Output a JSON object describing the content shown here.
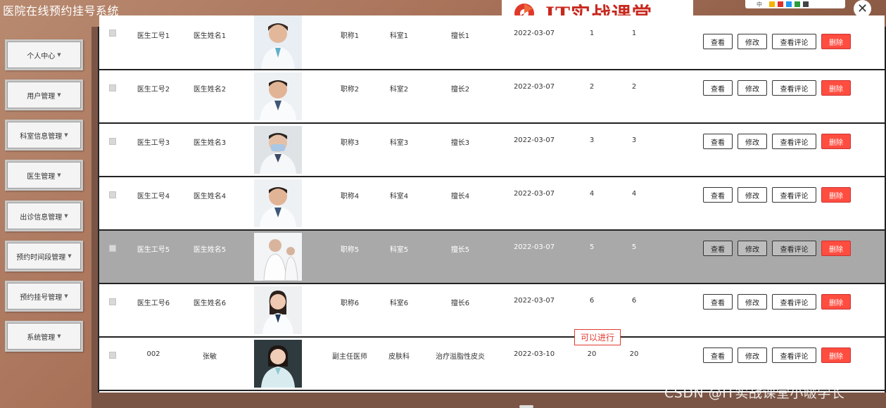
{
  "app": {
    "title": "医院在线预约挂号系统"
  },
  "brand": {
    "text": "IT实战课堂"
  },
  "toolbar": {
    "label": "中",
    "colors": [
      "#f5b400",
      "#e0302a",
      "#2196f3",
      "#2a9d3a",
      "#444444"
    ]
  },
  "close": {
    "glyph": "✕"
  },
  "sidebar": {
    "items": [
      {
        "label": "个人中心"
      },
      {
        "label": "用户管理"
      },
      {
        "label": "科室信息管理"
      },
      {
        "label": "医生管理"
      },
      {
        "label": "出诊信息管理"
      },
      {
        "label": "预约时间段管理"
      },
      {
        "label": "预约挂号管理"
      },
      {
        "label": "系统管理"
      }
    ]
  },
  "actions": {
    "view": "查看",
    "edit": "修改",
    "comments": "查看评论",
    "delete": "删除"
  },
  "table": {
    "rows": [
      {
        "id": "医生工号1",
        "name": "医生姓名1",
        "title": "职称1",
        "dept": "科室1",
        "specialty": "擅长1",
        "date": "2022-03-07",
        "n1": "1",
        "n2": "1"
      },
      {
        "id": "医生工号2",
        "name": "医生姓名2",
        "title": "职称2",
        "dept": "科室2",
        "specialty": "擅长2",
        "date": "2022-03-07",
        "n1": "2",
        "n2": "2"
      },
      {
        "id": "医生工号3",
        "name": "医生姓名3",
        "title": "职称3",
        "dept": "科室3",
        "specialty": "擅长3",
        "date": "2022-03-07",
        "n1": "3",
        "n2": "3"
      },
      {
        "id": "医生工号4",
        "name": "医生姓名4",
        "title": "职称4",
        "dept": "科室4",
        "specialty": "擅长4",
        "date": "2022-03-07",
        "n1": "4",
        "n2": "4"
      },
      {
        "id": "医生工号5",
        "name": "医生姓名5",
        "title": "职称5",
        "dept": "科室5",
        "specialty": "擅长5",
        "date": "2022-03-07",
        "n1": "5",
        "n2": "5"
      },
      {
        "id": "医生工号6",
        "name": "医生姓名6",
        "title": "职称6",
        "dept": "科室6",
        "specialty": "擅长6",
        "date": "2022-03-07",
        "n1": "6",
        "n2": "6"
      },
      {
        "id": "002",
        "name": "张敏",
        "title": "副主任医师",
        "dept": "皮肤科",
        "specialty": "治疗溢脂性皮炎",
        "date": "2022-03-10",
        "n1": "20",
        "n2": "20"
      }
    ]
  },
  "tooltip": {
    "text": "可以进行"
  },
  "watermark": {
    "text": "CSDN @IT实战课堂小啵学长"
  }
}
